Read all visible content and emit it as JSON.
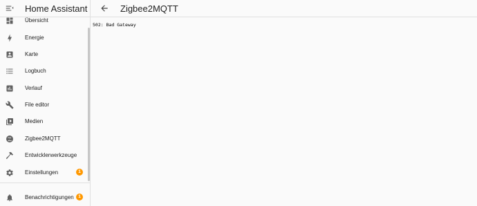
{
  "app": {
    "title": "Home Assistant"
  },
  "page": {
    "title": "Zigbee2MQTT",
    "error": "502: Bad Gateway"
  },
  "sidebar": {
    "items": [
      {
        "label": "Übersicht",
        "icon": "dashboard-icon"
      },
      {
        "label": "Energie",
        "icon": "lightning-bolt-icon"
      },
      {
        "label": "Karte",
        "icon": "map-icon"
      },
      {
        "label": "Logbuch",
        "icon": "format-list-bulleted-icon"
      },
      {
        "label": "Verlauf",
        "icon": "chart-box-icon"
      },
      {
        "label": "File editor",
        "icon": "wrench-icon"
      },
      {
        "label": "Medien",
        "icon": "play-box-multiple-icon"
      },
      {
        "label": "Zigbee2MQTT",
        "icon": "zigbee-icon"
      },
      {
        "label": "Entwicklerwerkzeuge",
        "icon": "hammer-icon"
      },
      {
        "label": "Einstellungen",
        "icon": "cog-icon",
        "badge": "1"
      }
    ],
    "notifications": {
      "label": "Benachrichtigungen",
      "icon": "bell-icon",
      "badge": "1"
    }
  },
  "colors": {
    "badge": "#ff9800",
    "icon": "#616161",
    "background": "#fafafa"
  }
}
